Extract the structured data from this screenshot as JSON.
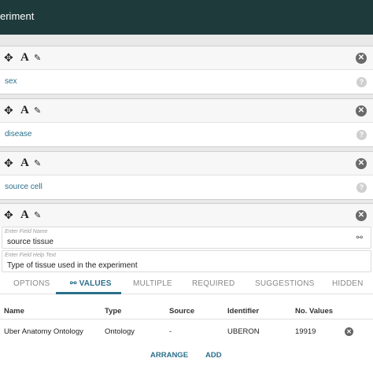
{
  "header": {
    "title": "eriment"
  },
  "fields": [
    {
      "label": "sex"
    },
    {
      "label": "disease"
    },
    {
      "label": "source cell"
    }
  ],
  "edit_field": {
    "name_hint": "Enter Field Name",
    "name_value": "source tissue",
    "help_hint": "Enter Field Help Text",
    "help_value": "Type of tissue used in the experiment"
  },
  "tabs": [
    {
      "label": "OPTIONS"
    },
    {
      "label": "VALUES"
    },
    {
      "label": "MULTIPLE"
    },
    {
      "label": "REQUIRED"
    },
    {
      "label": "SUGGESTIONS"
    },
    {
      "label": "HIDDEN"
    }
  ],
  "table": {
    "headers": [
      "Name",
      "Type",
      "Source",
      "Identifier",
      "No. Values"
    ],
    "rows": [
      [
        "Uber Anatomy Ontology",
        "Ontology",
        "-",
        "UBERON",
        "19919"
      ]
    ]
  },
  "actions": {
    "arrange": "ARRANGE",
    "add": "ADD"
  },
  "colors": {
    "header_bg": "#1e3a3b",
    "accent": "#2b6f8a"
  },
  "icons": [
    "move-icon",
    "font-icon",
    "edit-icon",
    "close-icon",
    "help-icon",
    "tree-icon"
  ]
}
